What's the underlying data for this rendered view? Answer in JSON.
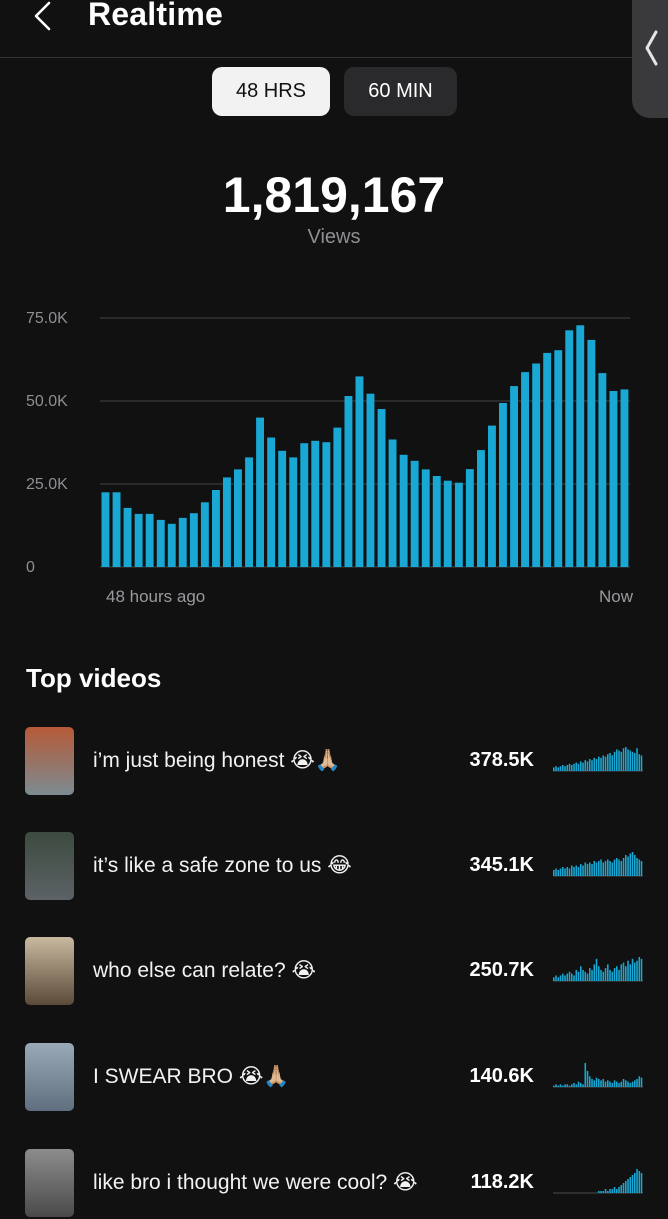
{
  "header": {
    "title": "Realtime"
  },
  "tabs": [
    {
      "label": "48 HRS",
      "selected": true
    },
    {
      "label": "60 MIN",
      "selected": false
    }
  ],
  "summary": {
    "total": "1,819,167",
    "label": "Views"
  },
  "chart_data": {
    "type": "bar",
    "color": "#19a7d4",
    "ylim": [
      0,
      75000
    ],
    "yticks": [
      "0",
      "25.0K",
      "50.0K",
      "75.0K"
    ],
    "x_start_label": "48 hours ago",
    "x_end_label": "Now",
    "values": [
      22500,
      22500,
      17800,
      16000,
      16000,
      14200,
      13000,
      14800,
      16200,
      19500,
      23200,
      27000,
      29400,
      33000,
      45000,
      39000,
      35000,
      33000,
      37300,
      38000,
      37600,
      42000,
      51500,
      57400,
      52200,
      47600,
      38400,
      33800,
      32000,
      29400,
      27400,
      26000,
      25400,
      29500,
      35200,
      42600,
      49400,
      54500,
      58700,
      61300,
      64500,
      65300,
      71300,
      72800,
      68400,
      58400,
      53000,
      53500
    ]
  },
  "top_videos": {
    "title": "Top videos",
    "items": [
      {
        "title": "i’m just being honest 😭🙏🏼",
        "views": "378.5K",
        "thumb_top": "#b65a38",
        "thumb_bottom": "#7c8b91",
        "trend": [
          3,
          4,
          3,
          4,
          5,
          4,
          5,
          6,
          5,
          6,
          7,
          6,
          8,
          7,
          9,
          8,
          10,
          9,
          11,
          10,
          12,
          11,
          13,
          12,
          14,
          15,
          13,
          16,
          18,
          17,
          16,
          19,
          20,
          18,
          17,
          16,
          15,
          19,
          14,
          13
        ]
      },
      {
        "title": "it’s like a safe zone to us 😂",
        "views": "345.1K",
        "thumb_top": "#3d4a3f",
        "thumb_bottom": "#5c6266",
        "trend": [
          4,
          5,
          4,
          5,
          6,
          5,
          6,
          5,
          7,
          6,
          7,
          6,
          8,
          7,
          9,
          8,
          9,
          8,
          10,
          9,
          10,
          11,
          9,
          10,
          11,
          10,
          9,
          11,
          12,
          11,
          10,
          12,
          14,
          13,
          15,
          16,
          14,
          12,
          11,
          10
        ]
      },
      {
        "title": "who else can relate? 😭",
        "views": "250.7K",
        "thumb_top": "#c9b9a0",
        "thumb_bottom": "#5a4a38",
        "trend": [
          2,
          3,
          2,
          3,
          4,
          3,
          4,
          5,
          4,
          3,
          6,
          5,
          8,
          6,
          5,
          4,
          7,
          6,
          9,
          12,
          8,
          6,
          5,
          7,
          9,
          6,
          5,
          7,
          8,
          6,
          9,
          10,
          8,
          11,
          9,
          12,
          10,
          11,
          13,
          12
        ]
      },
      {
        "title": "I SWEAR BRO 😭🙏🏼",
        "views": "140.6K",
        "thumb_top": "#9aa9b7",
        "thumb_bottom": "#5f6f7f",
        "trend": [
          1,
          2,
          1,
          2,
          1,
          2,
          2,
          1,
          2,
          3,
          2,
          4,
          3,
          2,
          18,
          12,
          8,
          6,
          5,
          7,
          6,
          5,
          6,
          4,
          5,
          4,
          3,
          5,
          4,
          3,
          4,
          6,
          5,
          4,
          3,
          4,
          5,
          6,
          8,
          7
        ]
      },
      {
        "title": "like bro i thought we were cool? 😭",
        "views": "118.2K",
        "thumb_top": "#8c8c8c",
        "thumb_bottom": "#4a4a4a",
        "trend": [
          0,
          0,
          0,
          0,
          0,
          0,
          0,
          0,
          0,
          0,
          0,
          0,
          0,
          0,
          0,
          0,
          0,
          0,
          0,
          0,
          1,
          1,
          1,
          2,
          1,
          2,
          2,
          3,
          2,
          3,
          4,
          5,
          6,
          7,
          8,
          9,
          10,
          12,
          11,
          10
        ]
      }
    ]
  }
}
